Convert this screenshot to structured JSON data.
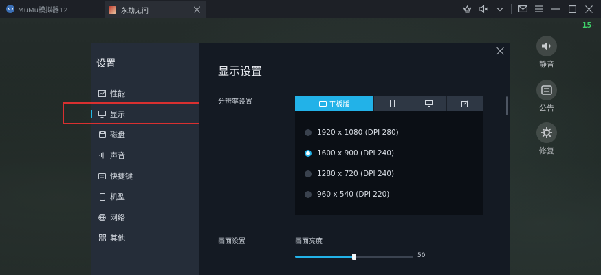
{
  "window": {
    "title": "MuMu模拟器12"
  },
  "tab": {
    "title": "永劫无间"
  },
  "overlay": {
    "fps": "15",
    "side_buttons": [
      {
        "label": "静音",
        "icon": "speaker-icon"
      },
      {
        "label": "公告",
        "icon": "notice-icon"
      },
      {
        "label": "修复",
        "icon": "repair-icon"
      }
    ]
  },
  "settings": {
    "title": "设置",
    "menu": [
      {
        "label": "性能",
        "icon": "performance-icon"
      },
      {
        "label": "显示",
        "icon": "display-icon",
        "active": true
      },
      {
        "label": "磁盘",
        "icon": "disk-icon"
      },
      {
        "label": "声音",
        "icon": "sound-icon"
      },
      {
        "label": "快捷键",
        "icon": "keyboard-icon"
      },
      {
        "label": "机型",
        "icon": "phone-icon"
      },
      {
        "label": "网络",
        "icon": "network-icon"
      },
      {
        "label": "其他",
        "icon": "grid-icon"
      }
    ]
  },
  "display": {
    "title": "显示设置",
    "resolution_label": "分辨率设置",
    "resolution_tabs": [
      {
        "label": "平板版",
        "icon": "tablet-icon",
        "active": true
      },
      {
        "label": "",
        "icon": "phone-icon"
      },
      {
        "label": "",
        "icon": "monitor-icon"
      },
      {
        "label": "",
        "icon": "edit-icon"
      }
    ],
    "resolution_options": [
      {
        "label": "1920 x 1080 (DPI 280)",
        "checked": false
      },
      {
        "label": "1600 x 900 (DPI 240)",
        "checked": true
      },
      {
        "label": "1280 x 720 (DPI 240)",
        "checked": false
      },
      {
        "label": "960 x 540 (DPI 220)",
        "checked": false
      }
    ],
    "picture_label": "画面设置",
    "brightness": {
      "label": "画面亮度",
      "value": 50,
      "max": 100,
      "value_text": "50"
    }
  },
  "colors": {
    "accent": "#22b2e8",
    "highlight": "#d93030",
    "fps": "#3fd26a"
  }
}
